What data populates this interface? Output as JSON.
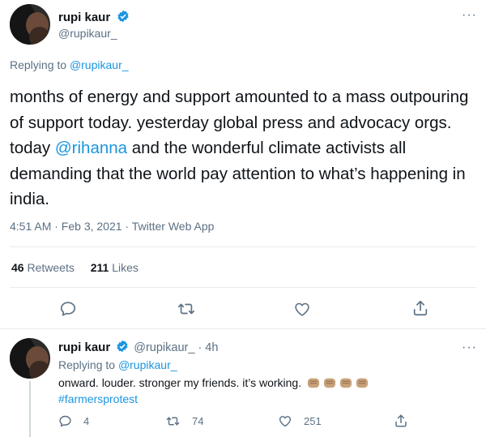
{
  "main_tweet": {
    "author_name": "rupi kaur",
    "author_handle": "@rupikaur_",
    "replying_prefix": "Replying to",
    "replying_handle": "@rupikaur_",
    "text_part1": "months of energy and support amounted to a mass outpouring of support today. yesterday global press and advocacy orgs. today ",
    "mention": "@rihanna",
    "text_part2": " and the wonderful climate activists all demanding that the world pay attention to what’s happening in india.",
    "timestamp": "4:51 AM · Feb 3, 2021 · Twitter Web App",
    "retweets_count": "46",
    "retweets_label": "Retweets",
    "likes_count": "211",
    "likes_label": "Likes"
  },
  "reply_tweet": {
    "author_name": "rupi kaur",
    "author_handle": "@rupikaur_",
    "time": "· 4h",
    "replying_prefix": "Replying to",
    "replying_handle": "@rupikaur_",
    "text": "onward. louder. stronger my friends. it’s working.",
    "hashtag": "#farmersprotest",
    "reply_count": "4",
    "retweet_count": "74",
    "like_count": "251"
  },
  "more_glyph": "···",
  "colors": {
    "accent": "#1b95e0",
    "secondary_text": "#5b7083",
    "divider": "#e6ecf0"
  },
  "icons": [
    "verified-badge-icon",
    "more-icon",
    "reply-icon",
    "retweet-icon",
    "like-icon",
    "share-icon",
    "raised-fist-emoji"
  ]
}
